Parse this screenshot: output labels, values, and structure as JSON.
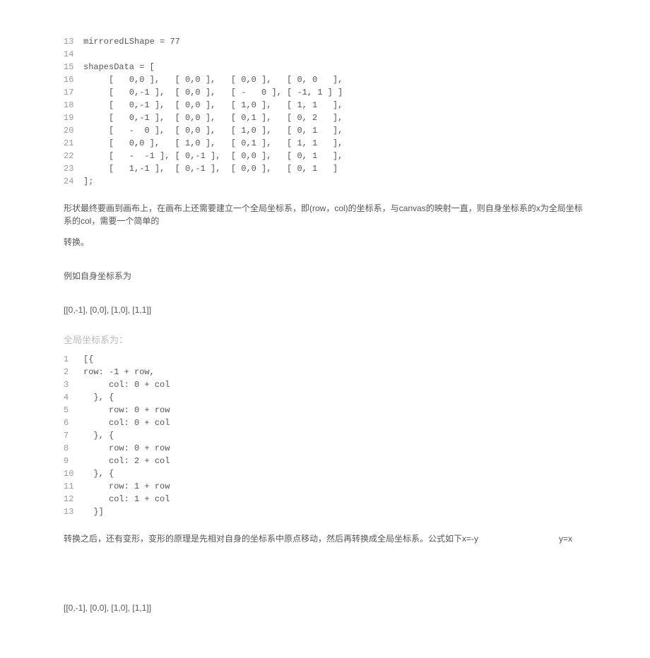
{
  "code1": {
    "lines": [
      {
        "n": "13",
        "t": "mirroredLShape = 77"
      },
      {
        "n": "14",
        "t": ""
      },
      {
        "n": "15",
        "t": "shapesData = ["
      },
      {
        "n": "16",
        "t": "     [   0,0 ],   [ 0,0 ],   [ 0,0 ],   [ 0, 0   ],"
      },
      {
        "n": "17",
        "t": "     [   0,-1 ],  [ 0,0 ],   [ -   0 ], [ -1, 1 ] ]"
      },
      {
        "n": "18",
        "t": "     [   0,-1 ],  [ 0,0 ],   [ 1,0 ],   [ 1, 1   ],"
      },
      {
        "n": "19",
        "t": "     [   0,-1 ],  [ 0,0 ],   [ 0,1 ],   [ 0, 2   ],"
      },
      {
        "n": "20",
        "t": "     [   -  0 ],  [ 0,0 ],   [ 1,0 ],   [ 0, 1   ],"
      },
      {
        "n": "21",
        "t": "     [   0,0 ],   [ 1,0 ],   [ 0,1 ],   [ 1, 1   ],"
      },
      {
        "n": "22",
        "t": "     [   -  -1 ], [ 0,-1 ],  [ 0,0 ],   [ 0, 1   ],"
      },
      {
        "n": "23",
        "t": "     [   1,-1 ],  [ 0,-1 ],  [ 0,0 ],   [ 0, 1   ]"
      },
      {
        "n": "24",
        "t": "];"
      }
    ]
  },
  "p1": "形状最终要画到画布上，在画布上还需要建立一个全局坐标系，即(row，col)的坐标系，与canvas的映射一直，则自身坐标系的x为全局坐标系的col，需要一个简单的",
  "p2": "转换。",
  "p3": "例如自身坐标系为",
  "coords1": "[[0,-1], [0,0], [1,0], [1,1]]",
  "heading1": "全局坐标系为：",
  "code2": {
    "lines": [
      {
        "n": "1",
        "t": "[{"
      },
      {
        "n": "2",
        "t": "row: -1 + row,"
      },
      {
        "n": "3",
        "t": "     col: 0 + col"
      },
      {
        "n": "4",
        "t": "  }, {"
      },
      {
        "n": "5",
        "t": "     row: 0 + row"
      },
      {
        "n": "6",
        "t": "     col: 0 + col"
      },
      {
        "n": "7",
        "t": "  }, {"
      },
      {
        "n": "8",
        "t": "     row: 0 + row"
      },
      {
        "n": "9",
        "t": "     col: 2 + col"
      },
      {
        "n": "10",
        "t": "  }, {"
      },
      {
        "n": "11",
        "t": "     row: 1 + row"
      },
      {
        "n": "12",
        "t": "     col: 1 + col"
      },
      {
        "n": "13",
        "t": "  }]"
      }
    ]
  },
  "p4a": "转换之后，还有变形，变形的原理是先相对自身的坐标系中原点移动，然后再转换成全局坐标系。公式如下x=-y",
  "p4b": "y=x",
  "coords2": "[[0,-1], [0,0], [1,0], [1,1]]"
}
